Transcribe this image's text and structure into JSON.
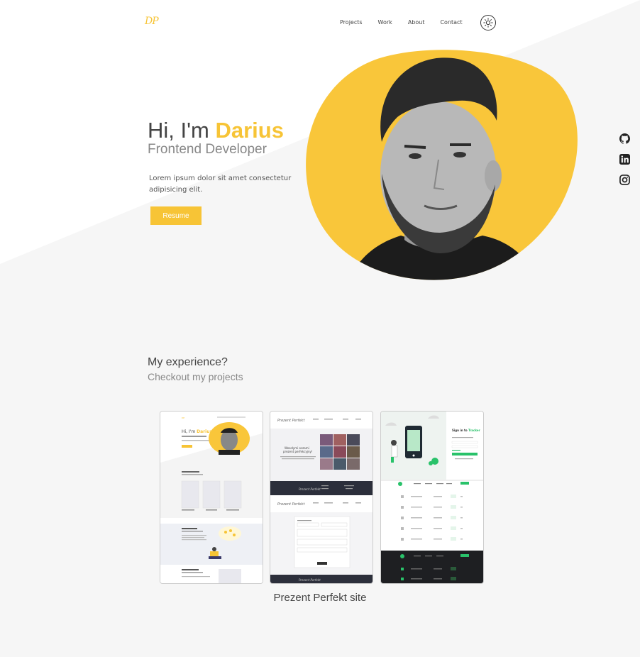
{
  "brand": {
    "logo_text": "DP",
    "accent": "#f7c436"
  },
  "nav": {
    "links": [
      "Projects",
      "Work",
      "About",
      "Contact"
    ],
    "theme_toggle_icon": "sun-icon"
  },
  "hero": {
    "greeting": "Hi, I'm ",
    "name": "Darius",
    "role": "Frontend Developer",
    "description": "Lorem ipsum dolor sit amet consectetur adipisicing elit.",
    "resume_label": "Resume"
  },
  "socials": [
    "github-icon",
    "linkedin-icon",
    "instagram-icon"
  ],
  "experience": {
    "title": "My experience?",
    "subtitle": "Checkout my projects",
    "project_caption": "Prezent Perfekt site"
  },
  "thumb2": {
    "heading": "Wesołymi oczami prezent perfekcyjny!"
  },
  "thumb3": {
    "heading": "Sign in to Tracker"
  }
}
